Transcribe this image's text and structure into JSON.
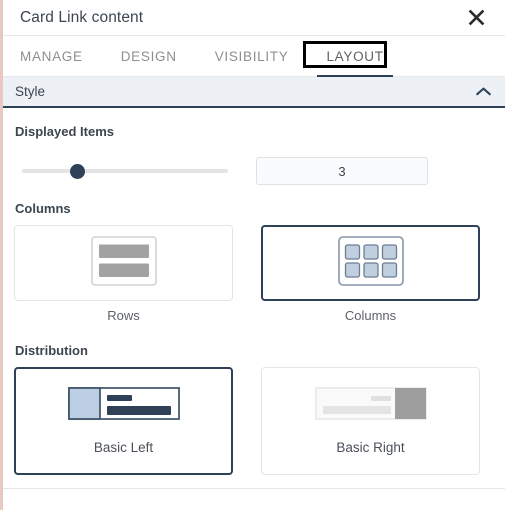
{
  "dialog": {
    "title": "Card Link content",
    "close_icon": "close-x-icon"
  },
  "tabs": [
    {
      "label": "MANAGE",
      "active": false
    },
    {
      "label": "DESIGN",
      "active": false
    },
    {
      "label": "VISIBILITY",
      "active": false
    },
    {
      "label": "LAYOUT",
      "active": true,
      "annotated": true
    }
  ],
  "accordion": {
    "label": "Style",
    "expanded": true,
    "chevron_icon": "chevron-up-icon"
  },
  "displayed_items": {
    "label": "Displayed Items",
    "value": "3",
    "slider": {
      "min": 1,
      "max": 12,
      "value": 3,
      "thumb_percent": 23
    }
  },
  "columns": {
    "label": "Columns",
    "options": [
      {
        "label": "Rows",
        "icon": "rows-layout-icon",
        "selected": false
      },
      {
        "label": "Columns",
        "icon": "columns-grid-icon",
        "selected": true
      }
    ]
  },
  "distribution": {
    "label": "Distribution",
    "options": [
      {
        "label": "Basic Left",
        "icon": "basic-left-layout-icon",
        "selected": true
      },
      {
        "label": "Basic Right",
        "icon": "basic-right-layout-icon",
        "selected": false
      }
    ]
  },
  "colors": {
    "accent": "#2f4157",
    "panel_header_bg": "#edf0f5",
    "muted_text": "#8d8f93",
    "annotation": "#000000"
  }
}
